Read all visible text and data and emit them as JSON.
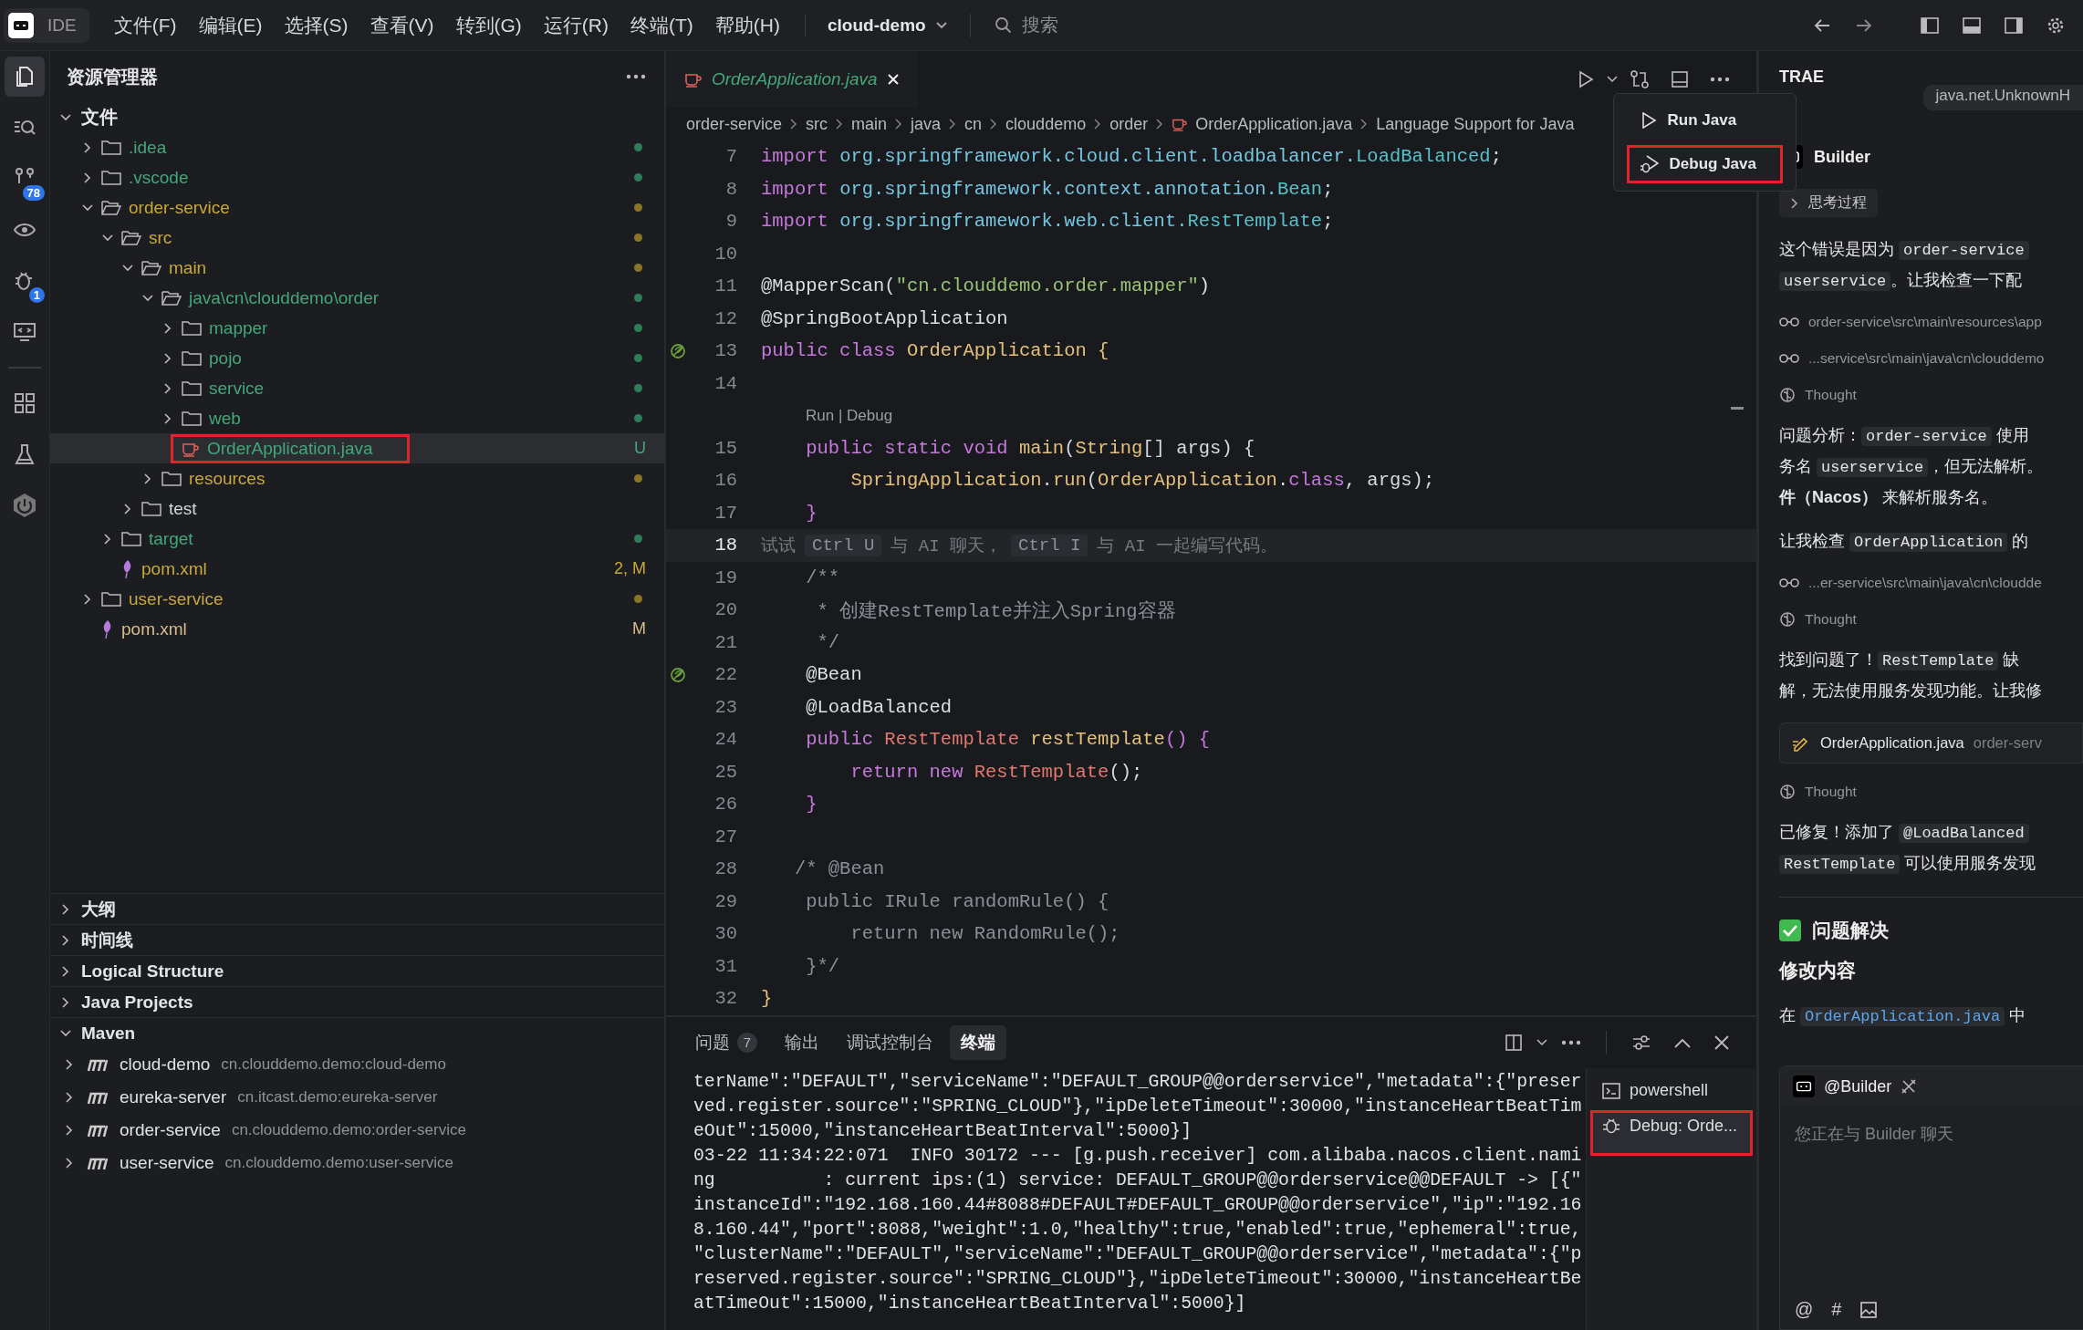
{
  "menubar": {
    "logo": "IDE",
    "menus": [
      "文件(F)",
      "编辑(E)",
      "选择(S)",
      "查看(V)",
      "转到(G)",
      "运行(R)",
      "终端(T)",
      "帮助(H)"
    ],
    "project": "cloud-demo",
    "search_placeholder": "搜索"
  },
  "activity_bar": [
    {
      "kind": "files",
      "selected": true
    },
    {
      "kind": "search",
      "selected": false
    },
    {
      "kind": "source-control",
      "selected": false,
      "badge": "78"
    },
    {
      "kind": "eye",
      "selected": false
    },
    {
      "kind": "debug",
      "selected": false,
      "badge": "1"
    },
    {
      "kind": "remote",
      "selected": false
    },
    {
      "kind": "extensions",
      "selected": false
    },
    {
      "kind": "testing",
      "selected": false
    },
    {
      "kind": "power",
      "selected": false
    }
  ],
  "explorer": {
    "title": "资源管理器",
    "root": {
      "label": "文件",
      "expanded": true
    },
    "tree": [
      {
        "name": ".idea",
        "kind": "folder",
        "expanded": false,
        "selected": false,
        "highlighted": false,
        "color": "#43a77b",
        "decoration": {
          "color": "#2f7d59"
        }
      },
      {
        "name": ".vscode",
        "kind": "folder",
        "expanded": false,
        "selected": false,
        "highlighted": false,
        "color": "#43a77b",
        "decoration": {
          "color": "#2f7d59"
        }
      },
      {
        "name": "order-service",
        "kind": "folder",
        "expanded": true,
        "selected": false,
        "highlighted": false,
        "color": "#c9a83a",
        "decoration": {
          "color": "#8a7526"
        },
        "children": [
          {
            "name": "src",
            "kind": "folder",
            "expanded": true,
            "selected": false,
            "highlighted": false,
            "color": "#c9a83a",
            "decoration": {
              "color": "#8a7526"
            },
            "children": [
              {
                "name": "main",
                "kind": "folder",
                "expanded": true,
                "selected": false,
                "highlighted": false,
                "color": "#c9a83a",
                "decoration": {
                  "color": "#8a7526"
                },
                "children": [
                  {
                    "name": "java\\cn\\clouddemo\\order",
                    "kind": "folder",
                    "expanded": true,
                    "selected": false,
                    "highlighted": false,
                    "color": "#43a77b",
                    "decoration": {
                      "color": "#2f7d59"
                    },
                    "children": [
                      {
                        "name": "mapper",
                        "kind": "folder",
                        "expanded": false,
                        "selected": false,
                        "highlighted": false,
                        "color": "#43a77b",
                        "decoration": {
                          "color": "#2f7d59"
                        }
                      },
                      {
                        "name": "pojo",
                        "kind": "folder",
                        "expanded": false,
                        "selected": false,
                        "highlighted": false,
                        "color": "#43a77b",
                        "decoration": {
                          "color": "#2f7d59"
                        }
                      },
                      {
                        "name": "service",
                        "kind": "folder",
                        "expanded": false,
                        "selected": false,
                        "highlighted": false,
                        "color": "#43a77b",
                        "decoration": {
                          "color": "#2f7d59"
                        }
                      },
                      {
                        "name": "web",
                        "kind": "folder",
                        "expanded": false,
                        "selected": false,
                        "highlighted": false,
                        "color": "#43a77b",
                        "decoration": {
                          "color": "#2f7d59"
                        }
                      },
                      {
                        "name": "OrderApplication.java",
                        "kind": "java",
                        "expanded": false,
                        "selected": true,
                        "highlighted": true,
                        "color": "#43a77b",
                        "decoration": {
                          "text": "U",
                          "color": "#43a77b"
                        }
                      }
                    ]
                  },
                  {
                    "name": "resources",
                    "kind": "folder",
                    "expanded": false,
                    "selected": false,
                    "highlighted": false,
                    "color": "#c9a83a",
                    "decoration": {
                      "color": "#8a7526"
                    }
                  }
                ]
              },
              {
                "name": "test",
                "kind": "folder",
                "expanded": false,
                "selected": false,
                "highlighted": false,
                "color": "#d4d6db"
              }
            ]
          },
          {
            "name": "target",
            "kind": "folder",
            "expanded": false,
            "selected": false,
            "highlighted": false,
            "color": "#43a77b",
            "decoration": {
              "color": "#2f7d59"
            }
          },
          {
            "name": "pom.xml",
            "kind": "xml",
            "expanded": false,
            "selected": false,
            "highlighted": false,
            "color": "#c9a83a",
            "decoration": {
              "text": "2, M",
              "color": "#c9a83a"
            }
          }
        ]
      },
      {
        "name": "user-service",
        "kind": "folder",
        "expanded": false,
        "selected": false,
        "highlighted": false,
        "color": "#c9a83a",
        "decoration": {
          "color": "#8a7526"
        }
      },
      {
        "name": "pom.xml",
        "kind": "xml",
        "expanded": false,
        "selected": false,
        "highlighted": false,
        "color": "#d8bb8c",
        "decoration": {
          "text": "M",
          "color": "#d8bb8c"
        }
      }
    ],
    "sections": [
      {
        "label": "大纲",
        "expanded": false
      },
      {
        "label": "时间线",
        "expanded": false
      },
      {
        "label": "Logical Structure",
        "expanded": false
      },
      {
        "label": "Java Projects",
        "expanded": false
      },
      {
        "label": "Maven",
        "expanded": true,
        "children": [
          {
            "name": "cloud-demo",
            "artifact": "cn.clouddemo.demo:cloud-demo",
            "expanded": false
          },
          {
            "name": "eureka-server",
            "artifact": "cn.itcast.demo:eureka-server",
            "expanded": false
          },
          {
            "name": "order-service",
            "artifact": "cn.clouddemo.demo:order-service",
            "expanded": false
          },
          {
            "name": "user-service",
            "artifact": "cn.clouddemo.demo:user-service",
            "expanded": false
          }
        ]
      }
    ]
  },
  "editor": {
    "tab": {
      "title": "OrderApplication.java"
    },
    "breadcrumbs": [
      {
        "label": "order-service",
        "kind": "folder"
      },
      {
        "label": "src",
        "kind": "folder"
      },
      {
        "label": "main",
        "kind": "folder"
      },
      {
        "label": "java",
        "kind": "folder"
      },
      {
        "label": "cn",
        "kind": "folder"
      },
      {
        "label": "clouddemo",
        "kind": "folder"
      },
      {
        "label": "order",
        "kind": "folder"
      },
      {
        "label": "OrderApplication.java",
        "kind": "java"
      },
      {
        "label": "Language Support for Java",
        "kind": "symbol"
      }
    ],
    "run_menu": [
      {
        "label": "Run Java",
        "kind": "run",
        "highlighted": false
      },
      {
        "label": "Debug Java",
        "kind": "debug",
        "highlighted": true
      }
    ],
    "lines": [
      {
        "num": "7",
        "kind": "code",
        "current": false,
        "marker": false,
        "tokens": [
          {
            "t": "import ",
            "kind": "kw"
          },
          {
            "t": "org.springframework.cloud.client.loadbalancer.",
            "kind": "ns"
          },
          {
            "t": "LoadBalanced",
            "kind": "ty"
          },
          {
            "t": ";",
            "kind": "p"
          }
        ]
      },
      {
        "num": "8",
        "kind": "code",
        "current": false,
        "marker": false,
        "tokens": [
          {
            "t": "import ",
            "kind": "kw"
          },
          {
            "t": "org.springframework.context.annotation.",
            "kind": "ns"
          },
          {
            "t": "Bean",
            "kind": "ty"
          },
          {
            "t": ";",
            "kind": "p"
          }
        ]
      },
      {
        "num": "9",
        "kind": "code",
        "current": false,
        "marker": false,
        "tokens": [
          {
            "t": "import ",
            "kind": "kw"
          },
          {
            "t": "org.springframework.web.client.",
            "kind": "ns"
          },
          {
            "t": "RestTemplate",
            "kind": "ty"
          },
          {
            "t": ";",
            "kind": "p"
          }
        ]
      },
      {
        "num": "10",
        "kind": "blank",
        "current": false,
        "marker": false
      },
      {
        "num": "11",
        "kind": "code",
        "current": false,
        "marker": false,
        "tokens": [
          {
            "t": "@MapperScan(",
            "kind": "ann"
          },
          {
            "t": "\"cn.clouddemo.order.mapper\"",
            "kind": "str"
          },
          {
            "t": ")",
            "kind": "ann"
          }
        ]
      },
      {
        "num": "12",
        "kind": "code",
        "current": false,
        "marker": false,
        "tokens": [
          {
            "t": "@SpringBootApplication",
            "kind": "ann"
          }
        ]
      },
      {
        "num": "13",
        "kind": "code",
        "current": false,
        "marker": true,
        "tokens": [
          {
            "t": "public class ",
            "kind": "kw"
          },
          {
            "t": "OrderApplication {",
            "kind": "cls"
          }
        ]
      },
      {
        "num": "14",
        "kind": "blank",
        "current": false,
        "marker": false
      },
      {
        "kind": "lens",
        "text": "Run | Debug"
      },
      {
        "num": "15",
        "kind": "code",
        "current": false,
        "marker": false,
        "tokens": [
          {
            "t": "    public static void ",
            "kind": "kw"
          },
          {
            "t": "main",
            "kind": "fn"
          },
          {
            "t": "(",
            "kind": "p"
          },
          {
            "t": "String",
            "kind": "cls"
          },
          {
            "t": "[] args) {",
            "kind": "p"
          }
        ]
      },
      {
        "num": "16",
        "kind": "code",
        "current": false,
        "marker": false,
        "tokens": [
          {
            "t": "        SpringApplication",
            "kind": "cls"
          },
          {
            "t": ".",
            "kind": "p"
          },
          {
            "t": "run",
            "kind": "fn"
          },
          {
            "t": "(",
            "kind": "p"
          },
          {
            "t": "OrderApplication",
            "kind": "cls"
          },
          {
            "t": ".",
            "kind": "p"
          },
          {
            "t": "class",
            "kind": "kw"
          },
          {
            "t": ", args);",
            "kind": "p"
          }
        ]
      },
      {
        "num": "17",
        "kind": "code",
        "current": false,
        "marker": false,
        "tokens": [
          {
            "t": "    }",
            "kind": "kw"
          }
        ]
      },
      {
        "num": "18",
        "kind": "hint",
        "current": true,
        "marker": false,
        "parts": [
          {
            "t": "试试",
            "key": false
          },
          {
            "t": "Ctrl U",
            "key": true
          },
          {
            "t": "与 AI 聊天，",
            "key": false
          },
          {
            "t": "Ctrl I",
            "key": true
          },
          {
            "t": "与 AI 一起编写代码。",
            "key": false
          }
        ]
      },
      {
        "num": "19",
        "kind": "code",
        "current": false,
        "marker": false,
        "tokens": [
          {
            "t": "    /**",
            "kind": "cm"
          }
        ]
      },
      {
        "num": "20",
        "kind": "code",
        "current": false,
        "marker": false,
        "tokens": [
          {
            "t": "     * 创建RestTemplate并注入Spring容器",
            "kind": "cm"
          }
        ]
      },
      {
        "num": "21",
        "kind": "code",
        "current": false,
        "marker": false,
        "tokens": [
          {
            "t": "     */",
            "kind": "cm"
          }
        ]
      },
      {
        "num": "22",
        "kind": "code",
        "current": false,
        "marker": true,
        "tokens": [
          {
            "t": "    @Bean",
            "kind": "ann"
          }
        ]
      },
      {
        "num": "23",
        "kind": "code",
        "current": false,
        "marker": false,
        "tokens": [
          {
            "t": "    @LoadBalanced",
            "kind": "ann"
          }
        ]
      },
      {
        "num": "24",
        "kind": "code",
        "current": false,
        "marker": false,
        "tokens": [
          {
            "t": "    public ",
            "kind": "kw"
          },
          {
            "t": "RestTemplate ",
            "kind": "rt"
          },
          {
            "t": "restTemplate",
            "kind": "fn"
          },
          {
            "t": "() {",
            "kind": "kw"
          }
        ]
      },
      {
        "num": "25",
        "kind": "code",
        "current": false,
        "marker": false,
        "tokens": [
          {
            "t": "        return new ",
            "kind": "kw"
          },
          {
            "t": "RestTemplate",
            "kind": "rt"
          },
          {
            "t": "();",
            "kind": "p"
          }
        ]
      },
      {
        "num": "26",
        "kind": "code",
        "current": false,
        "marker": false,
        "tokens": [
          {
            "t": "    }",
            "kind": "kw"
          }
        ]
      },
      {
        "num": "27",
        "kind": "blank",
        "current": false,
        "marker": false
      },
      {
        "num": "28",
        "kind": "code",
        "current": false,
        "marker": false,
        "tokens": [
          {
            "t": "   /* @Bean",
            "kind": "cm"
          }
        ]
      },
      {
        "num": "29",
        "kind": "code",
        "current": false,
        "marker": false,
        "tokens": [
          {
            "t": "    public IRule randomRule() {",
            "kind": "cm"
          }
        ]
      },
      {
        "num": "30",
        "kind": "code",
        "current": false,
        "marker": false,
        "tokens": [
          {
            "t": "        return new RandomRule();",
            "kind": "cm"
          }
        ]
      },
      {
        "num": "31",
        "kind": "code",
        "current": false,
        "marker": false,
        "tokens": [
          {
            "t": "    }*/",
            "kind": "cm"
          }
        ]
      },
      {
        "num": "32",
        "kind": "code",
        "current": false,
        "marker": false,
        "tokens": [
          {
            "t": "}",
            "kind": "cls"
          }
        ]
      }
    ]
  },
  "panel": {
    "tabs": [
      {
        "label": "问题",
        "count": "7",
        "selected": false
      },
      {
        "label": "输出",
        "selected": false
      },
      {
        "label": "调试控制台",
        "selected": false
      },
      {
        "label": "终端",
        "selected": true
      }
    ],
    "terminal_lines": [
      "terName\":\"DEFAULT\",\"serviceName\":\"DEFAULT_GROUP@@orderservice\",\"metadata\":{\"preser",
      "ved.register.source\":\"SPRING_CLOUD\"},\"ipDeleteTimeout\":30000,\"instanceHeartBeatTim",
      "eOut\":15000,\"instanceHeartBeatInterval\":5000}]",
      "03-22 11:34:22:071  INFO 30172 --- [g.push.receiver] com.alibaba.nacos.client.nami",
      "ng          : current ips:(1) service: DEFAULT_GROUP@@orderservice@@DEFAULT -> [{\"",
      "instanceId\":\"192.168.160.44#8088#DEFAULT#DEFAULT_GROUP@@orderservice\",\"ip\":\"192.16",
      "8.160.44\",\"port\":8088,\"weight\":1.0,\"healthy\":true,\"enabled\":true,\"ephemeral\":true,",
      "\"clusterName\":\"DEFAULT\",\"serviceName\":\"DEFAULT_GROUP@@orderservice\",\"metadata\":{\"p",
      "reserved.register.source\":\"SPRING_CLOUD\"},\"ipDeleteTimeout\":30000,\"instanceHeartBe",
      "atTimeOut\":15000,\"instanceHeartBeatInterval\":5000}]"
    ],
    "terminals": [
      {
        "label": "powershell",
        "kind": "shell",
        "selected": false,
        "highlighted": false
      },
      {
        "label": "Debug: Orde...",
        "kind": "debug",
        "selected": true,
        "highlighted": true
      }
    ]
  },
  "assistant": {
    "title": "TRAE",
    "bubble": "java.net.UnknownH",
    "agent": "Builder",
    "blocks": [
      {
        "kind": "chip",
        "text": "思考过程"
      },
      {
        "kind": "para",
        "lines": [
          [
            {
              "t": "这个错误是因为 ",
              "kind": "plain"
            },
            {
              "t": "order-service",
              "kind": "code"
            }
          ],
          [
            {
              "t": "userservice",
              "kind": "code"
            },
            {
              "t": "。让我检查一下配",
              "kind": "plain"
            }
          ]
        ]
      },
      {
        "kind": "file",
        "path": "order-service\\src\\main\\resources\\app"
      },
      {
        "kind": "file",
        "path": "...service\\src\\main\\java\\cn\\clouddemo"
      },
      {
        "kind": "thought",
        "text": "Thought"
      },
      {
        "kind": "para",
        "lines": [
          [
            {
              "t": "问题分析：",
              "kind": "plain"
            },
            {
              "t": "order-service",
              "kind": "code"
            },
            {
              "t": " 使用",
              "kind": "plain"
            }
          ],
          [
            {
              "t": "务名 ",
              "kind": "plain"
            },
            {
              "t": "userservice",
              "kind": "code"
            },
            {
              "t": "，但无法解析。",
              "kind": "plain"
            }
          ],
          [
            {
              "t": "件（Nacos）",
              "kind": "bold"
            },
            {
              "t": " 来解析服务名。",
              "kind": "plain"
            }
          ]
        ]
      },
      {
        "kind": "para",
        "lines": [
          [
            {
              "t": "让我检查 ",
              "kind": "plain"
            },
            {
              "t": "OrderApplication",
              "kind": "code"
            },
            {
              "t": " 的",
              "kind": "plain"
            }
          ]
        ]
      },
      {
        "kind": "file",
        "path": "...er-service\\src\\main\\java\\cn\\cloudde"
      },
      {
        "kind": "thought",
        "text": "Thought"
      },
      {
        "kind": "para",
        "lines": [
          [
            {
              "t": "找到问题了！",
              "kind": "plain"
            },
            {
              "t": "RestTemplate",
              "kind": "code"
            },
            {
              "t": " 缺",
              "kind": "plain"
            }
          ],
          [
            {
              "t": "解，无法使用服务发现功能。让我修",
              "kind": "plain"
            }
          ]
        ]
      },
      {
        "kind": "edit",
        "file": "OrderApplication.java",
        "dir": "order-serv"
      },
      {
        "kind": "thought",
        "text": "Thought"
      },
      {
        "kind": "para",
        "lines": [
          [
            {
              "t": "已修复！添加了 ",
              "kind": "plain"
            },
            {
              "t": "@LoadBalanced",
              "kind": "code"
            }
          ],
          [
            {
              "t": "RestTemplate",
              "kind": "code"
            },
            {
              "t": " 可以使用服务发现",
              "kind": "plain"
            }
          ]
        ]
      },
      {
        "kind": "divider"
      },
      {
        "kind": "done",
        "text": "问题解决"
      },
      {
        "kind": "heading",
        "text": "修改内容"
      },
      {
        "kind": "para",
        "lines": [
          [
            {
              "t": "在 ",
              "kind": "plain"
            },
            {
              "t": "OrderApplication.java",
              "kind": "link"
            },
            {
              "t": " 中",
              "kind": "plain"
            }
          ]
        ]
      }
    ],
    "chat": {
      "agent": "@Builder",
      "placeholder": "您正在与 Builder 聊天",
      "tools": [
        "@",
        "#"
      ]
    }
  }
}
